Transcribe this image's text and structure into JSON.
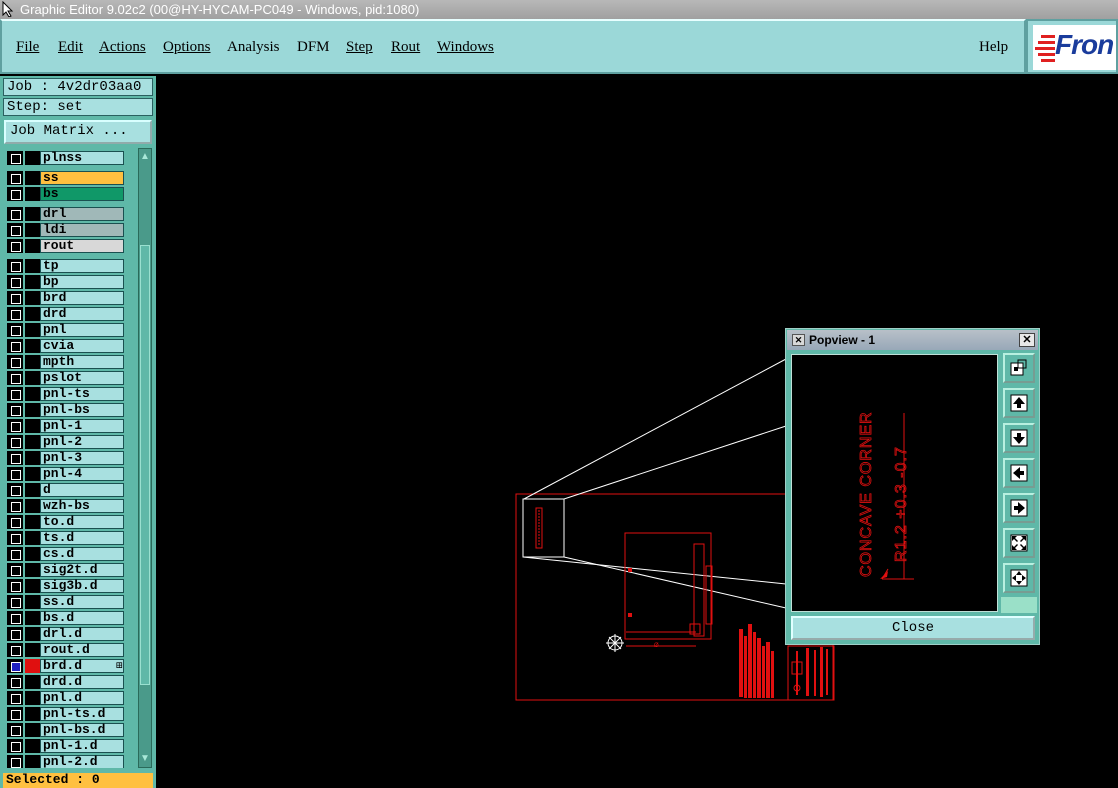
{
  "window": {
    "title": "Graphic Editor 9.02c2 (00@HY-HYCAM-PC049 - Windows, pid:1080)"
  },
  "menu": [
    {
      "label": "File",
      "name": "menu-file"
    },
    {
      "label": "Edit",
      "name": "menu-edit"
    },
    {
      "label": "Actions",
      "name": "menu-actions"
    },
    {
      "label": "Options",
      "name": "menu-options"
    },
    {
      "label": "Analysis",
      "name": "menu-analysis"
    },
    {
      "label": "DFM",
      "name": "menu-dfm"
    },
    {
      "label": "Step",
      "name": "menu-step"
    },
    {
      "label": "Rout",
      "name": "menu-rout"
    },
    {
      "label": "Windows",
      "name": "menu-windows"
    },
    {
      "label": "Help",
      "name": "menu-help"
    }
  ],
  "logo": {
    "text": "Fron"
  },
  "job": {
    "label": "Job : 4v2dr03aa0",
    "step": "Step: set",
    "matrix_button": "Job Matrix ..."
  },
  "layers": [
    {
      "name": "plnss",
      "color": "#a8e0e0"
    },
    {
      "name": "ss",
      "color": "#ffc040"
    },
    {
      "name": "bs",
      "color": "#109868"
    },
    {
      "name": "drl",
      "color": "#a0b8b8"
    },
    {
      "name": "ldi",
      "color": "#a0b8b8"
    },
    {
      "name": "rout",
      "color": "#d8d8d8"
    },
    {
      "name": "tp"
    },
    {
      "name": "bp"
    },
    {
      "name": "brd"
    },
    {
      "name": "drd"
    },
    {
      "name": "pnl"
    },
    {
      "name": "cvia"
    },
    {
      "name": "mpth"
    },
    {
      "name": "pslot"
    },
    {
      "name": "pnl-ts"
    },
    {
      "name": "pnl-bs"
    },
    {
      "name": "pnl-1"
    },
    {
      "name": "pnl-2"
    },
    {
      "name": "pnl-3"
    },
    {
      "name": "pnl-4"
    },
    {
      "name": "d"
    },
    {
      "name": "wzh-bs"
    },
    {
      "name": "to.d"
    },
    {
      "name": "ts.d"
    },
    {
      "name": "cs.d"
    },
    {
      "name": "sig2t.d"
    },
    {
      "name": "sig3b.d"
    },
    {
      "name": "ss.d"
    },
    {
      "name": "bs.d"
    },
    {
      "name": "drl.d"
    },
    {
      "name": "rout.d"
    },
    {
      "name": "brd.d",
      "active": true
    },
    {
      "name": "drd.d"
    },
    {
      "name": "pnl.d"
    },
    {
      "name": "pnl-ts.d"
    },
    {
      "name": "pnl-bs.d"
    },
    {
      "name": "pnl-1.d"
    },
    {
      "name": "pnl-2.d"
    }
  ],
  "status": {
    "selected": "Selected : 0"
  },
  "popview": {
    "title": "Popview - 1",
    "close_label": "Close",
    "text_line1": "CONCAVE CORNER",
    "text_line2": "R1.2 +0.3 -0.7"
  },
  "colors": {
    "panel": "#9bd8d8",
    "field": "#a8e0e0",
    "drawing": "#e01010",
    "background": "#000000"
  }
}
